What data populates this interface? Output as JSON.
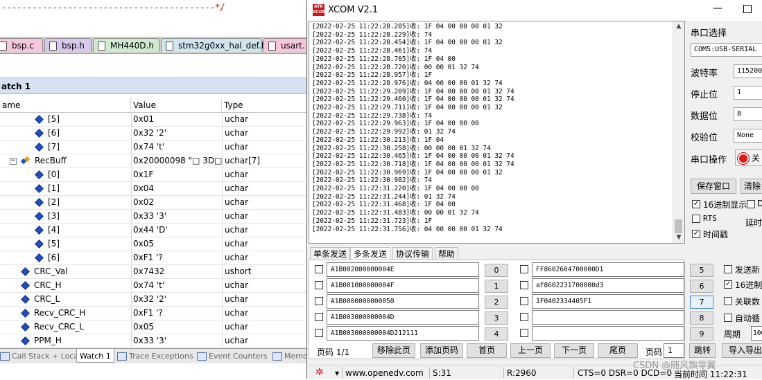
{
  "ide": {
    "code_line": "------------------------------------------*/",
    "file_tabs": [
      {
        "label": "bsp.c",
        "color": "#f5c6dd"
      },
      {
        "label": "bsp.h",
        "color": "#d9c8ee"
      },
      {
        "label": "MH440D.h",
        "color": "#cfeacf"
      },
      {
        "label": "stm32g0xx_hal_def.h",
        "color": "#cfe6ee"
      },
      {
        "label": "usart.",
        "color": "#f5c6dd"
      }
    ],
    "watch_title": "atch 1",
    "columns": {
      "name": "ame",
      "value": "Value",
      "type": "Type"
    },
    "rows": [
      {
        "name": "[5]",
        "value": "0x01",
        "type": "uchar",
        "indent": 2
      },
      {
        "name": "[6]",
        "value": "0x32 '2'",
        "type": "uchar",
        "indent": 2
      },
      {
        "name": "[7]",
        "value": "0x74 't'",
        "type": "uchar",
        "indent": 2
      },
      {
        "name": "RecBuff",
        "value": "0x20000098 \"□  3D□?",
        "type": "uchar[7]",
        "indent": 0,
        "expanded": true
      },
      {
        "name": "[0]",
        "value": "0x1F",
        "type": "uchar",
        "indent": 2
      },
      {
        "name": "[1]",
        "value": "0x04",
        "type": "uchar",
        "indent": 2
      },
      {
        "name": "[2]",
        "value": "0x02",
        "type": "uchar",
        "indent": 2
      },
      {
        "name": "[3]",
        "value": "0x33 '3'",
        "type": "uchar",
        "indent": 2
      },
      {
        "name": "[4]",
        "value": "0x44 'D'",
        "type": "uchar",
        "indent": 2
      },
      {
        "name": "[5]",
        "value": "0x05",
        "type": "uchar",
        "indent": 2
      },
      {
        "name": "[6]",
        "value": "0xF1 '?",
        "type": "uchar",
        "indent": 2
      },
      {
        "name": "CRC_Val",
        "value": "0x7432",
        "type": "ushort",
        "indent": 1
      },
      {
        "name": "CRC_H",
        "value": "0x74 't'",
        "type": "uchar",
        "indent": 1
      },
      {
        "name": "CRC_L",
        "value": "0x32 '2'",
        "type": "uchar",
        "indent": 1
      },
      {
        "name": "Recv_CRC_H",
        "value": "0xF1 '?",
        "type": "uchar",
        "indent": 1
      },
      {
        "name": "Recv_CRC_L",
        "value": "0x05",
        "type": "uchar",
        "indent": 1
      },
      {
        "name": "PPM_H",
        "value": "0x33 '3'",
        "type": "uchar",
        "indent": 1
      }
    ],
    "bottom_tabs": [
      "Call Stack + Locals",
      "Watch 1",
      "Trace Exceptions",
      "Event Counters",
      "Memo"
    ]
  },
  "xcom": {
    "title": "XCOM V2.1",
    "logo_text": "ATK XCOM",
    "minimize": "—",
    "log": [
      "[2022-02-25 11:22:28.205]收: 1F 04 00 00 00 01 32",
      "[2022-02-25 11:22:28.229]收: 74",
      "[2022-02-25 11:22:28.454]收: 1F 04 00 00 00 01 32",
      "[2022-02-25 11:22:28.461]收: 74",
      "[2022-02-25 11:22:28.705]收: 1F 04 00",
      "[2022-02-25 11:22:28.720]收: 00 00 01 32 74",
      "[2022-02-25 11:22:28.957]收: 1F",
      "[2022-02-25 11:22:28.976]收: 04 00 00 00 01 32 74",
      "[2022-02-25 11:22:29.209]收: 1F 04 00 00 00 01 32 74",
      "[2022-02-25 11:22:29.460]收: 1F 04 00 00 00 01 32 74",
      "[2022-02-25 11:22:29.711]收: 1F 04 00 00 00 01 32",
      "[2022-02-25 11:22:29.738]收: 74",
      "[2022-02-25 11:22:29.963]收: 1F 04 00 00 00",
      "[2022-02-25 11:22:29.992]收: 01 32 74",
      "[2022-02-25 11:22:30.213]收: 1F 04",
      "[2022-02-25 11:22:30.258]收: 00 00 00 01 32 74",
      "[2022-02-25 11:22:30.465]收: 1F 04 00 00 00 01 32 74",
      "[2022-02-25 11:22:30.718]收: 1F 04 00 00 00 01 32 74",
      "[2022-02-25 11:22:30.969]收: 1F 04 00 00 00 01 32",
      "[2022-02-25 11:22:30.982]收: 74",
      "[2022-02-25 11:22:31.220]收: 1F 04 00 00 00",
      "[2022-02-25 11:22:31.244]收: 01 32 74",
      "[2022-02-25 11:22:31.468]收: 1F 04 00",
      "[2022-02-25 11:22:31.483]收: 00 00 01 32 74",
      "[2022-02-25 11:22:31.723]收: 1F",
      "[2022-02-25 11:22:31.756]收: 04 00 00 00 01 32 74"
    ],
    "settings": {
      "port_label": "串口选择",
      "port_value": "COM5:USB-SERIAL",
      "baud_label": "波特率",
      "baud_value": "115200",
      "stop_label": "停止位",
      "stop_value": "1",
      "data_label": "数据位",
      "data_value": "8",
      "parity_label": "校验位",
      "parity_value": "None",
      "op_label": "串口操作",
      "op_button": "关",
      "save_button": "保存窗口",
      "clear_button": "清除",
      "hex_display": "16进制显示",
      "dtr": "D",
      "rts": "RTS",
      "delay": "延时",
      "timestamp": "时间戳"
    },
    "tabs": [
      "单条发送",
      "多条发送",
      "协议传输",
      "帮助"
    ],
    "multi_left": [
      {
        "value": "A1B002000000004E",
        "num": "0"
      },
      {
        "value": "A1B001000000004F",
        "num": "1"
      },
      {
        "value": "A1B0000000000050",
        "num": "2"
      },
      {
        "value": "A1B003000000004D",
        "num": "3"
      },
      {
        "value": "A1B003000000004D212111",
        "num": "4"
      }
    ],
    "multi_right": [
      {
        "value": "FF8602604700000D1",
        "num": "5"
      },
      {
        "value": "af8602231700000d3",
        "num": "6"
      },
      {
        "value": "1F0402334405F1",
        "num": "7"
      },
      {
        "value": "",
        "num": "8"
      },
      {
        "value": "",
        "num": "9"
      }
    ],
    "side_options": {
      "send_new": "发送新",
      "hex_send": "16进制",
      "link": "关联数",
      "auto_loop": "自动循",
      "period_label": "周期",
      "period_value": "100"
    },
    "pagebar": {
      "page_label": "页码 1/1",
      "remove": "移除此页",
      "add": "添加页码",
      "first": "首页",
      "prev": "上一页",
      "next": "下一页",
      "last": "尾页",
      "page_field_label": "页码",
      "page_field_value": "1",
      "jump": "跳转",
      "import": "导入导出"
    },
    "status": {
      "url": "www.openedv.com",
      "s": "S:31",
      "r": "R:2960",
      "lines": "CTS=0 DSR=0 DCD=0",
      "time": "当前时间 11:22:31",
      "watermark": "CSDN @随风飘零翼"
    },
    "colors": {
      "accent_red": "#c8161d",
      "watch_header": "#d6e2f3"
    }
  }
}
